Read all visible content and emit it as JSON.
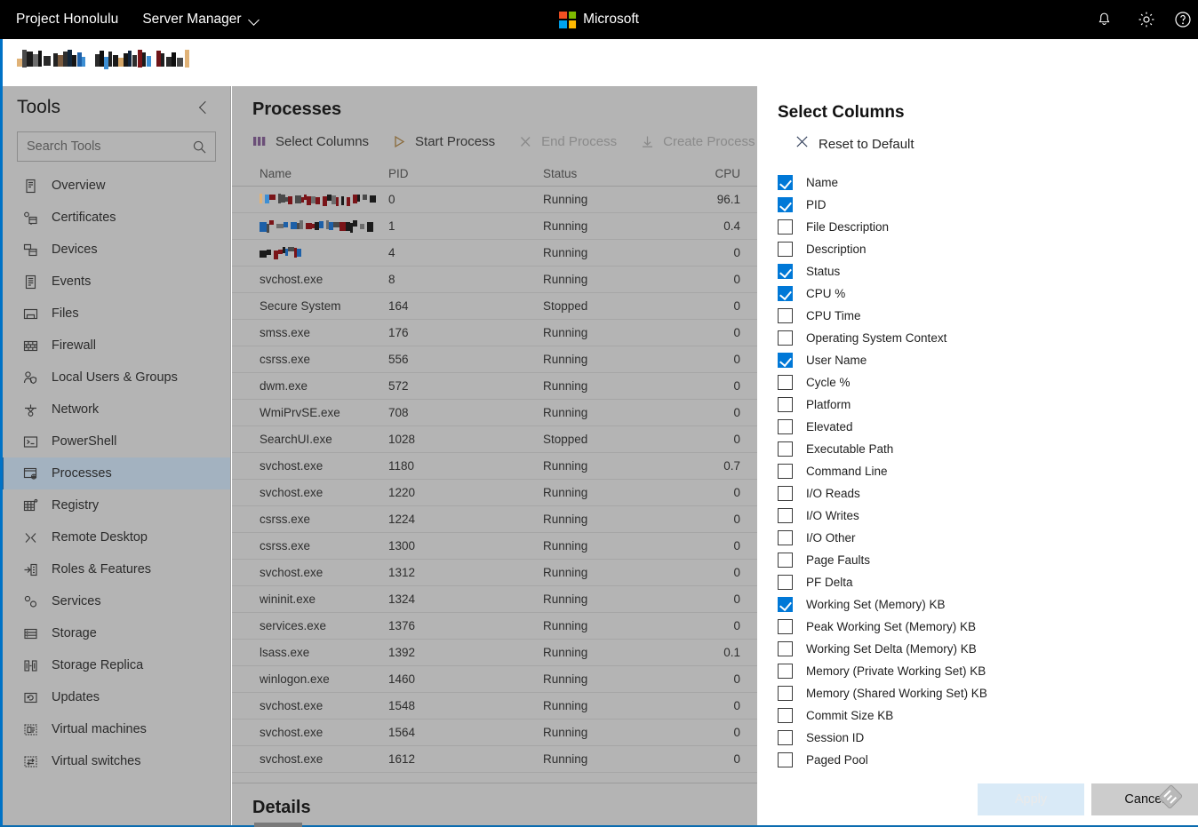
{
  "topbar": {
    "brand": "Project Honolulu",
    "app_name": "Server Manager",
    "chevron_icon": "chevron-down-icon",
    "microsoft_word": "Microsoft",
    "logo_colors": [
      "#f25022",
      "#7fba00",
      "#00a4ef",
      "#ffb900"
    ],
    "icons": [
      "bell-icon",
      "gear-icon",
      "help-icon"
    ],
    "background": "#000000"
  },
  "server_bar": {
    "server_name_redacted": true
  },
  "sidebar": {
    "title": "Tools",
    "collapse_icon": "chevron-left-icon",
    "search": {
      "placeholder": "Search Tools",
      "value": "",
      "icon": "search-icon"
    },
    "selected": "Processes",
    "accent_color": "#225f92",
    "items": [
      {
        "label": "Overview",
        "icon": "overview-icon"
      },
      {
        "label": "Certificates",
        "icon": "certificate-icon"
      },
      {
        "label": "Devices",
        "icon": "device-icon"
      },
      {
        "label": "Events",
        "icon": "events-icon"
      },
      {
        "label": "Files",
        "icon": "folder-icon"
      },
      {
        "label": "Firewall",
        "icon": "firewall-icon"
      },
      {
        "label": "Local Users & Groups",
        "icon": "users-icon"
      },
      {
        "label": "Network",
        "icon": "network-icon"
      },
      {
        "label": "PowerShell",
        "icon": "powershell-icon"
      },
      {
        "label": "Processes",
        "icon": "processes-icon"
      },
      {
        "label": "Registry",
        "icon": "registry-icon"
      },
      {
        "label": "Remote Desktop",
        "icon": "remote-desktop-icon"
      },
      {
        "label": "Roles & Features",
        "icon": "roles-features-icon"
      },
      {
        "label": "Services",
        "icon": "services-icon"
      },
      {
        "label": "Storage",
        "icon": "storage-icon"
      },
      {
        "label": "Storage Replica",
        "icon": "storage-replica-icon"
      },
      {
        "label": "Updates",
        "icon": "updates-icon"
      },
      {
        "label": "Virtual machines",
        "icon": "virtual-machine-icon"
      },
      {
        "label": "Virtual switches",
        "icon": "virtual-switch-icon"
      }
    ]
  },
  "main": {
    "title": "Processes",
    "details_title": "Details",
    "toolbar": [
      {
        "label": "Select Columns",
        "icon": "columns-icon",
        "disabled": false
      },
      {
        "label": "Start Process",
        "icon": "play-icon",
        "disabled": false
      },
      {
        "label": "End Process",
        "icon": "close-x-icon",
        "disabled": true
      },
      {
        "label": "Create Process",
        "icon": "download-arrow-icon",
        "disabled": true
      }
    ],
    "columns": [
      "Name",
      "PID",
      "Status",
      "CPU"
    ],
    "rows": [
      {
        "name": "",
        "redacted": true,
        "pid": "0",
        "status": "Running",
        "cpu": "96.1"
      },
      {
        "name": "",
        "redacted": true,
        "pid": "1",
        "status": "Running",
        "cpu": "0.4"
      },
      {
        "name": "",
        "redacted": true,
        "pid": "4",
        "status": "Running",
        "cpu": "0"
      },
      {
        "name": "svchost.exe",
        "redacted": false,
        "pid": "8",
        "status": "Running",
        "cpu": "0"
      },
      {
        "name": "Secure System",
        "redacted": false,
        "pid": "164",
        "status": "Stopped",
        "cpu": "0"
      },
      {
        "name": "smss.exe",
        "redacted": false,
        "pid": "176",
        "status": "Running",
        "cpu": "0"
      },
      {
        "name": "csrss.exe",
        "redacted": false,
        "pid": "556",
        "status": "Running",
        "cpu": "0"
      },
      {
        "name": "dwm.exe",
        "redacted": false,
        "pid": "572",
        "status": "Running",
        "cpu": "0"
      },
      {
        "name": "WmiPrvSE.exe",
        "redacted": false,
        "pid": "708",
        "status": "Running",
        "cpu": "0"
      },
      {
        "name": "SearchUI.exe",
        "redacted": false,
        "pid": "1028",
        "status": "Stopped",
        "cpu": "0"
      },
      {
        "name": "svchost.exe",
        "redacted": false,
        "pid": "1180",
        "status": "Running",
        "cpu": "0.7"
      },
      {
        "name": "svchost.exe",
        "redacted": false,
        "pid": "1220",
        "status": "Running",
        "cpu": "0"
      },
      {
        "name": "csrss.exe",
        "redacted": false,
        "pid": "1224",
        "status": "Running",
        "cpu": "0"
      },
      {
        "name": "csrss.exe",
        "redacted": false,
        "pid": "1300",
        "status": "Running",
        "cpu": "0"
      },
      {
        "name": "svchost.exe",
        "redacted": false,
        "pid": "1312",
        "status": "Running",
        "cpu": "0"
      },
      {
        "name": "wininit.exe",
        "redacted": false,
        "pid": "1324",
        "status": "Running",
        "cpu": "0"
      },
      {
        "name": "services.exe",
        "redacted": false,
        "pid": "1376",
        "status": "Running",
        "cpu": "0"
      },
      {
        "name": "lsass.exe",
        "redacted": false,
        "pid": "1392",
        "status": "Running",
        "cpu": "0.1"
      },
      {
        "name": "winlogon.exe",
        "redacted": false,
        "pid": "1460",
        "status": "Running",
        "cpu": "0"
      },
      {
        "name": "svchost.exe",
        "redacted": false,
        "pid": "1548",
        "status": "Running",
        "cpu": "0"
      },
      {
        "name": "svchost.exe",
        "redacted": false,
        "pid": "1564",
        "status": "Running",
        "cpu": "0"
      },
      {
        "name": "svchost.exe",
        "redacted": false,
        "pid": "1612",
        "status": "Running",
        "cpu": "0"
      }
    ]
  },
  "panel": {
    "title": "Select Columns",
    "reset_label": "Reset to Default",
    "reset_icon": "close-x-icon",
    "checked_color": "#0078d7",
    "columns": [
      {
        "label": "Name",
        "checked": true
      },
      {
        "label": "PID",
        "checked": true
      },
      {
        "label": "File Description",
        "checked": false
      },
      {
        "label": "Description",
        "checked": false
      },
      {
        "label": "Status",
        "checked": true
      },
      {
        "label": "CPU %",
        "checked": true
      },
      {
        "label": "CPU Time",
        "checked": false
      },
      {
        "label": "Operating System Context",
        "checked": false
      },
      {
        "label": "User Name",
        "checked": true
      },
      {
        "label": "Cycle %",
        "checked": false
      },
      {
        "label": "Platform",
        "checked": false
      },
      {
        "label": "Elevated",
        "checked": false
      },
      {
        "label": "Executable Path",
        "checked": false
      },
      {
        "label": "Command Line",
        "checked": false
      },
      {
        "label": "I/O Reads",
        "checked": false
      },
      {
        "label": "I/O Writes",
        "checked": false
      },
      {
        "label": "I/O Other",
        "checked": false
      },
      {
        "label": "Page Faults",
        "checked": false
      },
      {
        "label": "PF Delta",
        "checked": false
      },
      {
        "label": "Working Set (Memory) KB",
        "checked": true
      },
      {
        "label": "Peak Working Set (Memory) KB",
        "checked": false
      },
      {
        "label": "Working Set Delta (Memory) KB",
        "checked": false
      },
      {
        "label": "Memory (Private Working Set) KB",
        "checked": false
      },
      {
        "label": "Memory (Shared Working Set) KB",
        "checked": false
      },
      {
        "label": "Commit Size KB",
        "checked": false
      },
      {
        "label": "Session ID",
        "checked": false
      },
      {
        "label": "Paged Pool",
        "checked": false
      }
    ],
    "apply_label": "Apply",
    "apply_disabled": true,
    "cancel_label": "Cancel"
  }
}
